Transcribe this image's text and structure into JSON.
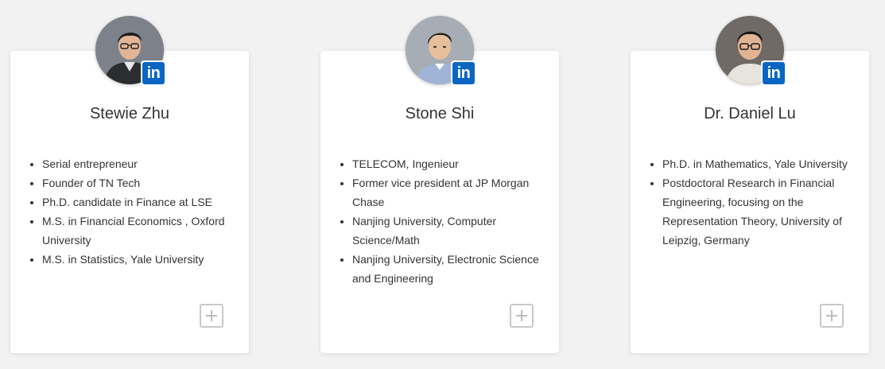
{
  "colors": {
    "background": "#f2f2f2",
    "card": "#ffffff",
    "text": "#333333",
    "linkedin": "#0a66c2",
    "plus_border": "#c8c8c8"
  },
  "team": [
    {
      "name": "Stewie Zhu",
      "linkedin_label": "in",
      "bullets": [
        "Serial entrepreneur",
        "Founder of TN Tech",
        "Ph.D. candidate in Finance at LSE",
        "M.S. in Financial Economics , Oxford University",
        "M.S. in Statistics, Yale University"
      ]
    },
    {
      "name": "Stone Shi",
      "linkedin_label": "in",
      "bullets": [
        "TELECOM, Ingenieur",
        "Former vice president at JP Morgan Chase",
        "Nanjing University, Computer Science/Math",
        "Nanjing University, Electronic Science and Engineering"
      ]
    },
    {
      "name": "Dr. Daniel Lu",
      "linkedin_label": "in",
      "bullets": [
        "Ph.D. in Mathematics, Yale University",
        "Postdoctoral Research in Financial Engineering, focusing on the Representation Theory, University of Leipzig, Germany"
      ]
    }
  ]
}
